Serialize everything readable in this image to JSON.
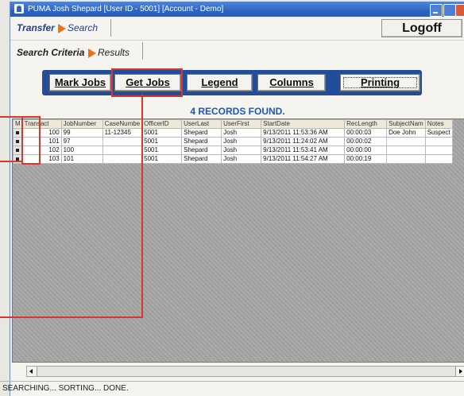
{
  "window": {
    "title": "PUMA  Josh Shepard [User ID - 5001] [Account - Demo]"
  },
  "tabs_top": {
    "transfer": "Transfer",
    "search": "Search"
  },
  "logoff_label": "Logoff",
  "tabs_sub": {
    "criteria": "Search Criteria",
    "results": "Results"
  },
  "toolbar": {
    "mark_jobs": "Mark Jobs",
    "get_jobs": "Get Jobs",
    "legend": "Legend",
    "columns": "Columns",
    "printing": "Printing"
  },
  "records_found": "4 RECORDS FOUND.",
  "table": {
    "headers": [
      "M",
      "Transact",
      "JobNumber",
      "CaseNumbe",
      "OfficerID",
      "UserLast",
      "UserFirst",
      "StartDate",
      "RecLength",
      "SubjectNam",
      "Notes"
    ],
    "rows": [
      {
        "transact": "100",
        "job": "99",
        "case": "11-12345",
        "officer": "5001",
        "last": "Shepard",
        "first": "Josh",
        "start": "9/13/2011 11:53:36 AM",
        "len": "00:00:03",
        "subject": "Doe John",
        "notes": "Suspect"
      },
      {
        "transact": "101",
        "job": "97",
        "case": "",
        "officer": "5001",
        "last": "Shepard",
        "first": "Josh",
        "start": "9/13/2011 11:24:02 AM",
        "len": "00:00:02",
        "subject": "",
        "notes": ""
      },
      {
        "transact": "102",
        "job": "100",
        "case": "",
        "officer": "5001",
        "last": "Shepard",
        "first": "Josh",
        "start": "9/13/2011 11:53:41 AM",
        "len": "00:00:00",
        "subject": "",
        "notes": ""
      },
      {
        "transact": "103",
        "job": "101",
        "case": "",
        "officer": "5001",
        "last": "Shepard",
        "first": "Josh",
        "start": "9/13/2011 11:54:27 AM",
        "len": "00:00:19",
        "subject": "",
        "notes": ""
      }
    ]
  },
  "status_text": "SEARCHING... SORTING... DONE.",
  "colors": {
    "titlebar": "#2d64c0",
    "toolbar": "#224d99",
    "accent_arrow": "#e8731c",
    "highlight": "#d8382b",
    "records_text": "#1e57b9"
  }
}
